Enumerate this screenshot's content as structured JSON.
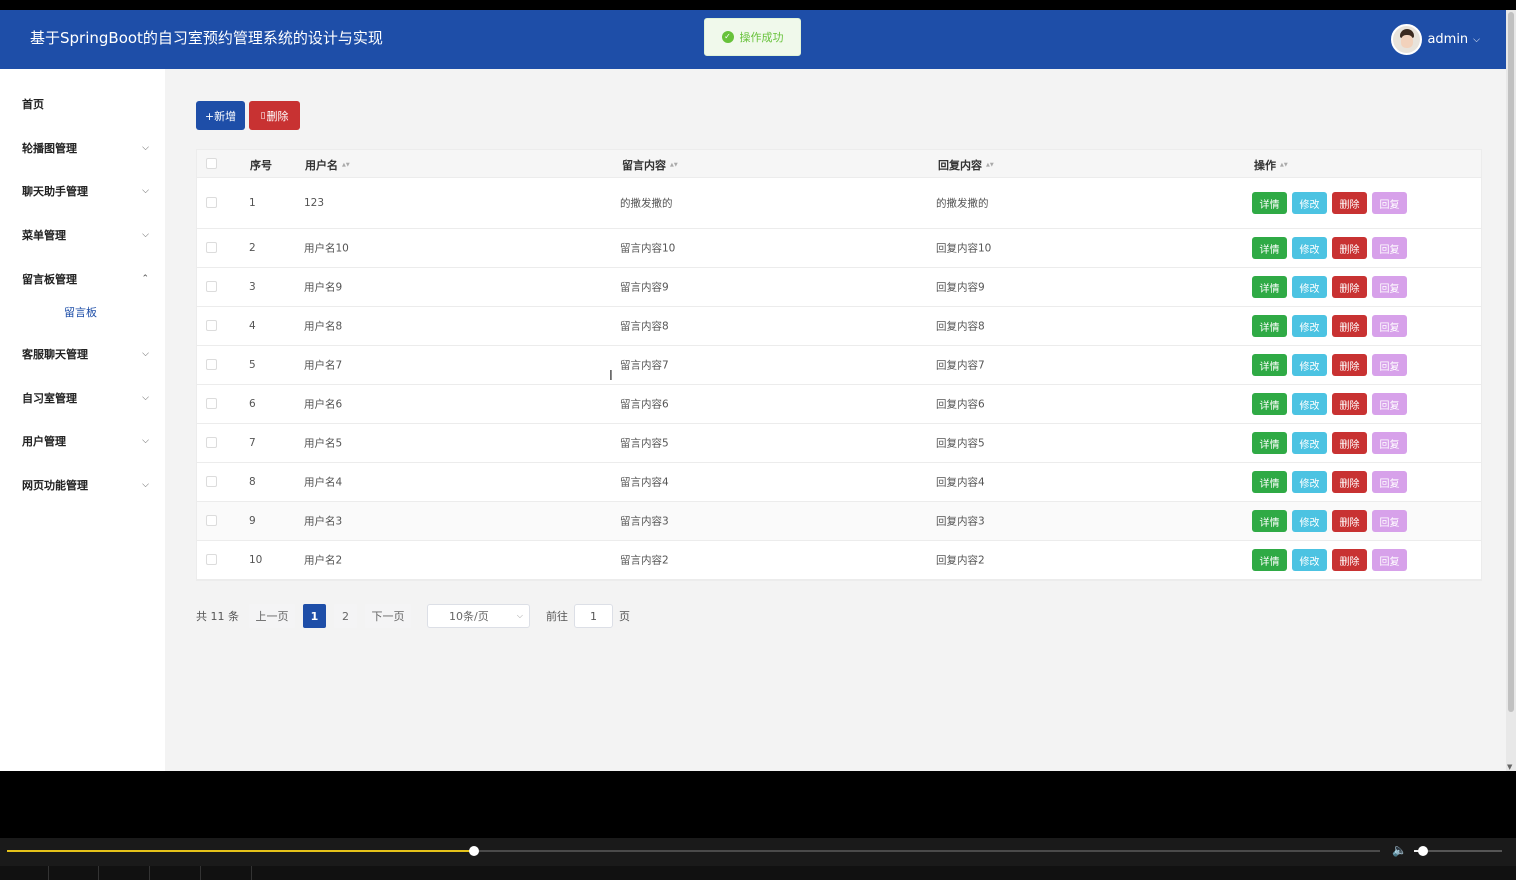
{
  "header": {
    "title": "基于SpringBoot的自习室预约管理系统的设计与实现",
    "toast": "操作成功",
    "user": "admin"
  },
  "sidebar": {
    "items": [
      {
        "label": "首页",
        "has_chevron": false
      },
      {
        "label": "轮播图管理",
        "has_chevron": true
      },
      {
        "label": "聊天助手管理",
        "has_chevron": true
      },
      {
        "label": "菜单管理",
        "has_chevron": true
      },
      {
        "label": "留言板管理",
        "has_chevron": true,
        "expanded": true
      },
      {
        "label": "客服聊天管理",
        "has_chevron": true
      },
      {
        "label": "自习室管理",
        "has_chevron": true
      },
      {
        "label": "用户管理",
        "has_chevron": true
      },
      {
        "label": "网页功能管理",
        "has_chevron": true
      }
    ],
    "submenu_label": "留言板"
  },
  "toolbar": {
    "add_label": "+新增",
    "delete_label": "删除"
  },
  "table": {
    "headers": {
      "index": "序号",
      "username": "用户名",
      "content": "留言内容",
      "reply": "回复内容",
      "actions": "操作"
    },
    "rows": [
      {
        "index": "1",
        "username": "123",
        "content": "的撒发撒的",
        "reply": "的撒发撒的"
      },
      {
        "index": "2",
        "username": "用户名10",
        "content": "留言内容10",
        "reply": "回复内容10"
      },
      {
        "index": "3",
        "username": "用户名9",
        "content": "留言内容9",
        "reply": "回复内容9"
      },
      {
        "index": "4",
        "username": "用户名8",
        "content": "留言内容8",
        "reply": "回复内容8"
      },
      {
        "index": "5",
        "username": "用户名7",
        "content": "留言内容7",
        "reply": "回复内容7"
      },
      {
        "index": "6",
        "username": "用户名6",
        "content": "留言内容6",
        "reply": "回复内容6"
      },
      {
        "index": "7",
        "username": "用户名5",
        "content": "留言内容5",
        "reply": "回复内容5"
      },
      {
        "index": "8",
        "username": "用户名4",
        "content": "留言内容4",
        "reply": "回复内容4"
      },
      {
        "index": "9",
        "username": "用户名3",
        "content": "留言内容3",
        "reply": "回复内容3"
      },
      {
        "index": "10",
        "username": "用户名2",
        "content": "留言内容2",
        "reply": "回复内容2"
      }
    ],
    "action_labels": {
      "detail": "详情",
      "edit": "修改",
      "delete": "删除",
      "reply": "回复"
    }
  },
  "pagination": {
    "total": "共 11 条",
    "prev": "上一页",
    "pages": [
      "1",
      "2"
    ],
    "current": "1",
    "next": "下一页",
    "page_size": "10条/页",
    "goto_label": "前往",
    "goto_value": "1",
    "page_suffix": "页"
  },
  "player": {
    "progress": 0.34,
    "volume": 0.1
  },
  "colors": {
    "brand": "#1e4ea8",
    "danger": "#c83232",
    "success": "#2faa45",
    "info": "#4cc3e2",
    "reply": "#d7a1ea"
  }
}
